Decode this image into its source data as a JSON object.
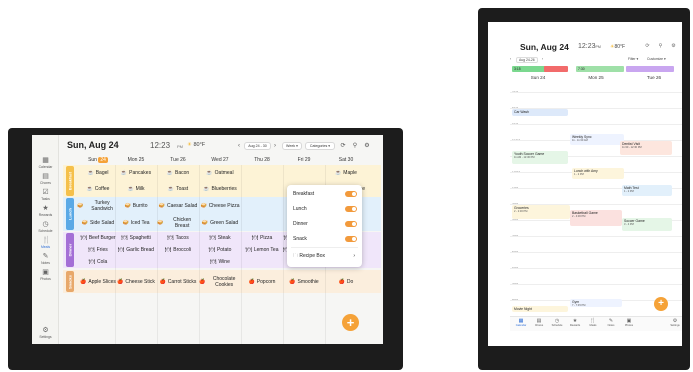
{
  "landscape": {
    "date": "Sun, Aug 24",
    "time": "12:23",
    "ampm": "PM",
    "weather": "80°F",
    "weather_icon": "sun-icon",
    "range_label": "Aug 24 - 30",
    "view_label": "Week",
    "categories_label": "Categories",
    "sidebar": [
      {
        "label": "Calendar",
        "icon": "calendar-icon"
      },
      {
        "label": "Chores",
        "icon": "chores-icon"
      },
      {
        "label": "Tasks",
        "icon": "tasks-icon"
      },
      {
        "label": "Rewards",
        "icon": "rewards-icon"
      },
      {
        "label": "Schedule",
        "icon": "schedule-icon"
      },
      {
        "label": "Meals",
        "icon": "meals-icon"
      },
      {
        "label": "Notes",
        "icon": "notes-icon"
      },
      {
        "label": "Photos",
        "icon": "photos-icon"
      },
      {
        "label": "Settings",
        "icon": "settings-icon"
      }
    ],
    "days": [
      "Sun 24",
      "Mon 25",
      "Tue 26",
      "Wed 27",
      "Thu 28",
      "Fri 29",
      "Sat 30"
    ],
    "today_badge": "24",
    "meals": {
      "breakfast": {
        "label": "Breakfast",
        "color": "#f5c04a",
        "band": "#fdf3d6",
        "rows": [
          [
            "Bagel",
            "Pancakes",
            "Bacon",
            "Oatmeal",
            "",
            "",
            "Maple"
          ],
          [
            "Coffee",
            "Milk",
            "Toast",
            "Blueberries",
            "",
            "",
            "Orange Juice"
          ]
        ]
      },
      "lunch": {
        "label": "Lunch",
        "color": "#5aa9e6",
        "band": "#e2f0fb",
        "rows": [
          [
            "Turkey Sandwich",
            "Burrito",
            "Caesar Salad",
            "Cheese Pizza",
            "",
            "",
            "Tuna Sandwich"
          ],
          [
            "Side Salad",
            "Iced Tea",
            "Chicken Breast",
            "Green Salad",
            "",
            "",
            "Side Salad"
          ]
        ]
      },
      "dinner": {
        "label": "Dinner",
        "color": "#a46fd6",
        "band": "#f0e6fa",
        "rows": [
          [
            "Beef Burger",
            "Spaghetti",
            "Tacos",
            "Steak",
            "Pizza",
            "Roast Chicken",
            "BBQ"
          ],
          [
            "Fries",
            "Garlic Bread",
            "Broccoli",
            "Potato",
            "Lemon Tea",
            "Mashed Potatoes",
            ""
          ],
          [
            "Cola",
            "",
            "",
            "Wine",
            "",
            "",
            ""
          ]
        ]
      },
      "snacks": {
        "label": "Snacks",
        "color": "#e8a86a",
        "band": "#fbeedd",
        "rows": [
          [
            "Apple Slices",
            "Cheese Stick",
            "Carrot Sticks",
            "Chocolate Cookies",
            "Popcorn",
            "Smoothie",
            "Do"
          ]
        ]
      }
    },
    "dropdown": {
      "items": [
        "Breakfast",
        "Lunch",
        "Dinner",
        "Snack"
      ],
      "recipe_box": "Recipe Box"
    },
    "fab": "+"
  },
  "portrait": {
    "date": "Sun, Aug 24",
    "time": "12:23",
    "ampm": "PM",
    "weather": "80°F",
    "range_label": "Aug 24-26",
    "filter_label": "Filter",
    "customize_label": "Customize",
    "all_day_bands": [
      {
        "label": "3:15",
        "color": "#7bd88f"
      },
      {
        "label": "",
        "color": "#f26b6b"
      },
      {
        "label": "7:30",
        "color": "#9fe0a8"
      },
      {
        "label": "",
        "color": "#c9a6f0"
      }
    ],
    "days": [
      "Sun 24",
      "Mon 25",
      "Tue 26"
    ],
    "hours": [
      "7AM",
      "8AM",
      "9AM",
      "10AM",
      "11AM",
      "12PM",
      "1PM",
      "2PM",
      "3PM",
      "4PM",
      "5PM",
      "6PM",
      "7PM",
      "8PM"
    ],
    "events": [
      {
        "title": "Car Wash",
        "sub": "",
        "color": "#dde9fa"
      },
      {
        "title": "Weekly Sync",
        "sub": "11 - 11:30 AM",
        "color": "#eef3ff"
      },
      {
        "title": "Dentist Visit",
        "sub": "11:30 - 12:30 PM",
        "color": "#fde6de"
      },
      {
        "title": "Youth Soccer Game",
        "sub": "11 AM - 12:30 PM",
        "color": "#e5f6e7"
      },
      {
        "title": "Lunch with Amy",
        "sub": "1 - 2 PM",
        "color": "#fdf5dc"
      },
      {
        "title": "Math Test",
        "sub": "1 - 2 PM",
        "color": "#e2f0fb"
      },
      {
        "title": "Groceries",
        "sub": "2 - 2:30 PM",
        "color": "#fdf5dc"
      },
      {
        "title": "Basketball Game",
        "sub": "2 - 4:30 PM",
        "color": "#fbe1df"
      },
      {
        "title": "Soccer Game",
        "sub": "3 - 4 PM",
        "color": "#e5f6e7"
      },
      {
        "title": "Gym",
        "sub": "7 - 7:45 PM",
        "color": "#eef3ff"
      },
      {
        "title": "Movie Night",
        "sub": "",
        "color": "#fdf5dc"
      }
    ],
    "tabs": [
      "Calendar",
      "Chores",
      "Schedule",
      "Rewards",
      "Meals",
      "Notes",
      "Photos",
      "Settings"
    ],
    "fab": "+"
  }
}
